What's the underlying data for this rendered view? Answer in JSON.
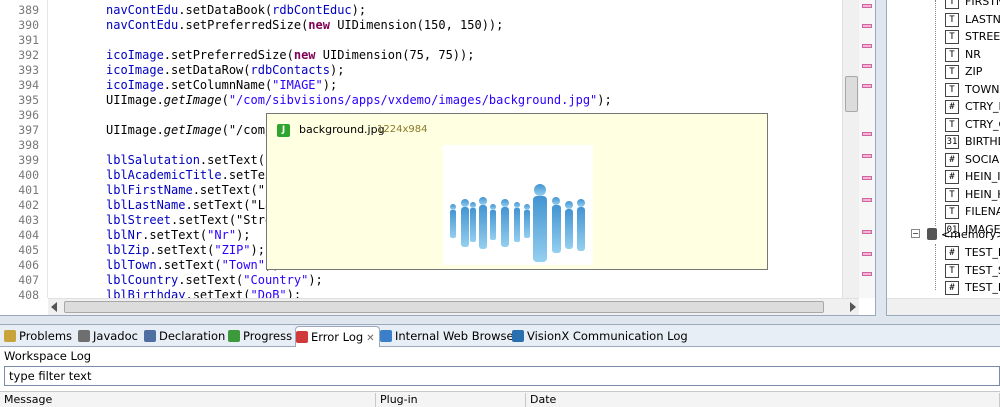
{
  "editor": {
    "lines": [
      {
        "n": "389",
        "code": "navContEdu.setDataBook(rdbContEduc);"
      },
      {
        "n": "390",
        "code": "navContEdu.setPreferredSize(new UIDimension(150, 150));"
      },
      {
        "n": "391",
        "code": ""
      },
      {
        "n": "392",
        "code": "icoImage.setPreferredSize(new UIDimension(75, 75));"
      },
      {
        "n": "393",
        "code": "icoImage.setDataRow(rdbContacts);"
      },
      {
        "n": "394",
        "code": "icoImage.setColumnName(\"IMAGE\");"
      },
      {
        "n": "395",
        "code": "UIImage.getImage(\"/com/sibvisions/apps/vxdemo/images/background.jpg\");"
      },
      {
        "n": "396",
        "code": ""
      },
      {
        "n": "397",
        "code": "UIImage.getImage(\"/com/"
      },
      {
        "n": "398",
        "code": ""
      },
      {
        "n": "399",
        "code": "lblSalutation.setText(\""
      },
      {
        "n": "400",
        "code": "lblAcademicTitle.setTex"
      },
      {
        "n": "401",
        "code": "lblFirstName.setText(\"F"
      },
      {
        "n": "402",
        "code": "lblLastName.setText(\"La"
      },
      {
        "n": "403",
        "code": "lblStreet.setText(\"Stre"
      },
      {
        "n": "404",
        "code": "lblNr.setText(\"Nr\");"
      },
      {
        "n": "405",
        "code": "lblZip.setText(\"ZIP\");"
      },
      {
        "n": "406",
        "code": "lblTown.setText(\"Town\");"
      },
      {
        "n": "407",
        "code": "lblCountry.setText(\"Country\");"
      },
      {
        "n": "408",
        "code": "lblBirthday.setText(\"DoB\");"
      }
    ]
  },
  "popup": {
    "file_name": "background.jpg",
    "dimensions": "1224x984",
    "icon_letter": "J"
  },
  "outline": {
    "items": [
      {
        "icon": "T",
        "label": "FIRSTNA"
      },
      {
        "icon": "T",
        "label": "LASTNA"
      },
      {
        "icon": "T",
        "label": "STREET"
      },
      {
        "icon": "T",
        "label": "NR"
      },
      {
        "icon": "T",
        "label": "ZIP"
      },
      {
        "icon": "T",
        "label": "TOWN"
      },
      {
        "icon": "#",
        "label": "CTRY_I"
      },
      {
        "icon": "T",
        "label": "CTRY_C"
      },
      {
        "icon": "31",
        "label": "BIRTHD"
      },
      {
        "icon": "#",
        "label": "SOCIAL"
      },
      {
        "icon": "#",
        "label": "HEIN_I"
      },
      {
        "icon": "T",
        "label": "HEIN_H"
      },
      {
        "icon": "T",
        "label": "FILENA"
      },
      {
        "icon": "01",
        "label": "IMAGE"
      }
    ],
    "memory_label": "<memory>",
    "memory_items": [
      {
        "icon": "#",
        "label": "TEST_E"
      },
      {
        "icon": "T",
        "label": "TEST_S"
      },
      {
        "icon": "#",
        "label": "TEST_E"
      }
    ]
  },
  "bottom": {
    "tabs": [
      {
        "label": "Problems",
        "icon_color": "#c8a43c"
      },
      {
        "label": "Javadoc",
        "icon_color": "#6f6f6f"
      },
      {
        "label": "Declaration",
        "icon_color": "#4f6fa3"
      },
      {
        "label": "Progress",
        "icon_color": "#3c9a3c"
      },
      {
        "label": "Error Log",
        "icon_color": "#d03a3a",
        "active": true
      },
      {
        "label": "Internal Web Browser",
        "icon_color": "#3a7fc8"
      },
      {
        "label": "VisionX Communication Log",
        "icon_color": "#2a6fb0"
      }
    ],
    "log_title": "Workspace Log",
    "filter_value": "type filter text",
    "columns": [
      "Message",
      "Plug-in",
      "Date"
    ]
  }
}
